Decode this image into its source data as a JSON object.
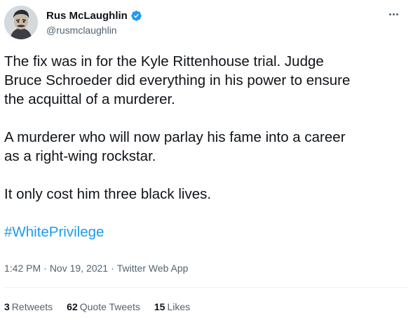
{
  "author": {
    "display_name": "Rus McLaughlin",
    "handle": "@rusmclaughlin",
    "verified": true
  },
  "tweet": {
    "paragraphs": [
      "The fix was in for the Kyle Rittenhouse trial. Judge",
      "Bruce Schroeder did everything in his power to ensure",
      "the acquittal of a murderer.",
      "A murderer who will now parlay his fame into a career",
      "as a right-wing rockstar.",
      "It only cost him three black lives."
    ],
    "hashtag": "#WhitePrivilege"
  },
  "meta": {
    "time": "1:42 PM",
    "date": "Nov 19, 2021",
    "source": "Twitter Web App",
    "separator": "·"
  },
  "stats": {
    "retweets_count": "3",
    "retweets_label": "Retweets",
    "quote_count": "62",
    "quote_label": "Quote Tweets",
    "likes_count": "15",
    "likes_label": "Likes"
  },
  "colors": {
    "link": "#1d9bf0",
    "secondary_text": "#536471",
    "primary_text": "#0f1419",
    "divider": "#eff3f4"
  },
  "icons": {
    "verified": "verified-badge-icon",
    "more": "more-options-icon"
  }
}
